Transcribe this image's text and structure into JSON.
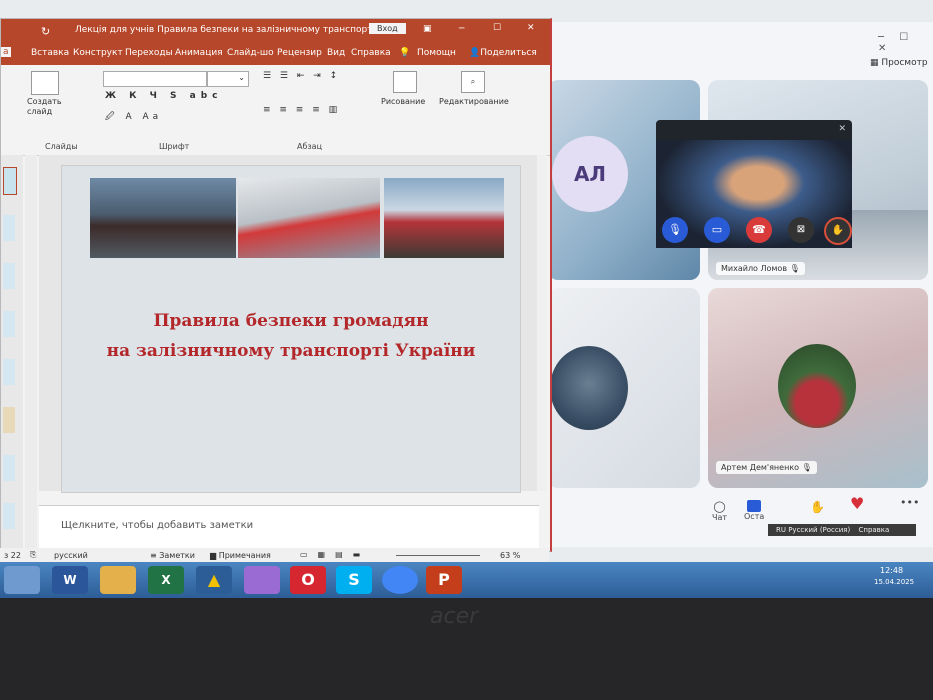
{
  "ppt": {
    "title": "Лекція для учнів Правила безпеки на залізничному транспорті...",
    "signin": "Вход",
    "tabs": [
      "Вставка",
      "Конструкт",
      "Переходы",
      "Анимация",
      "Слайд-шо",
      "Рецензир",
      "Вид",
      "Справка",
      "Помощн",
      "Поделиться"
    ],
    "groups": {
      "create_slide": "Создать слайд",
      "slides": "Слайды",
      "font": "Шрифт",
      "paragraph": "Абзац",
      "drawing": "Рисование",
      "editing": "Редактирование"
    },
    "slide_title_line1": "Правила безпеки громадян",
    "slide_title_line2": "на залізничному транспорті України",
    "notes_placeholder": "Щелкните, чтобы добавить заметки",
    "status": {
      "slide": "з 22",
      "language": "русский",
      "notes": "Заметки",
      "comments": "Примечания",
      "zoom": "63 %"
    }
  },
  "call": {
    "view_button": "Просмотр",
    "avatar_initials": "АЛ",
    "participants": [
      "Михайло Ломов",
      "Артем Дем'яненко"
    ],
    "chat_label": "Чат",
    "leave_label": "Оста"
  },
  "tray": {
    "lang": "RU Русский (Россия)",
    "help": "Справка",
    "time": "12:48",
    "date": "15.04.2025"
  },
  "bezel": {
    "brand": "acer"
  },
  "colors": {
    "ppt_accent": "#b7472a",
    "title_text": "#b3272a",
    "taskbar": "#3a70ad"
  }
}
